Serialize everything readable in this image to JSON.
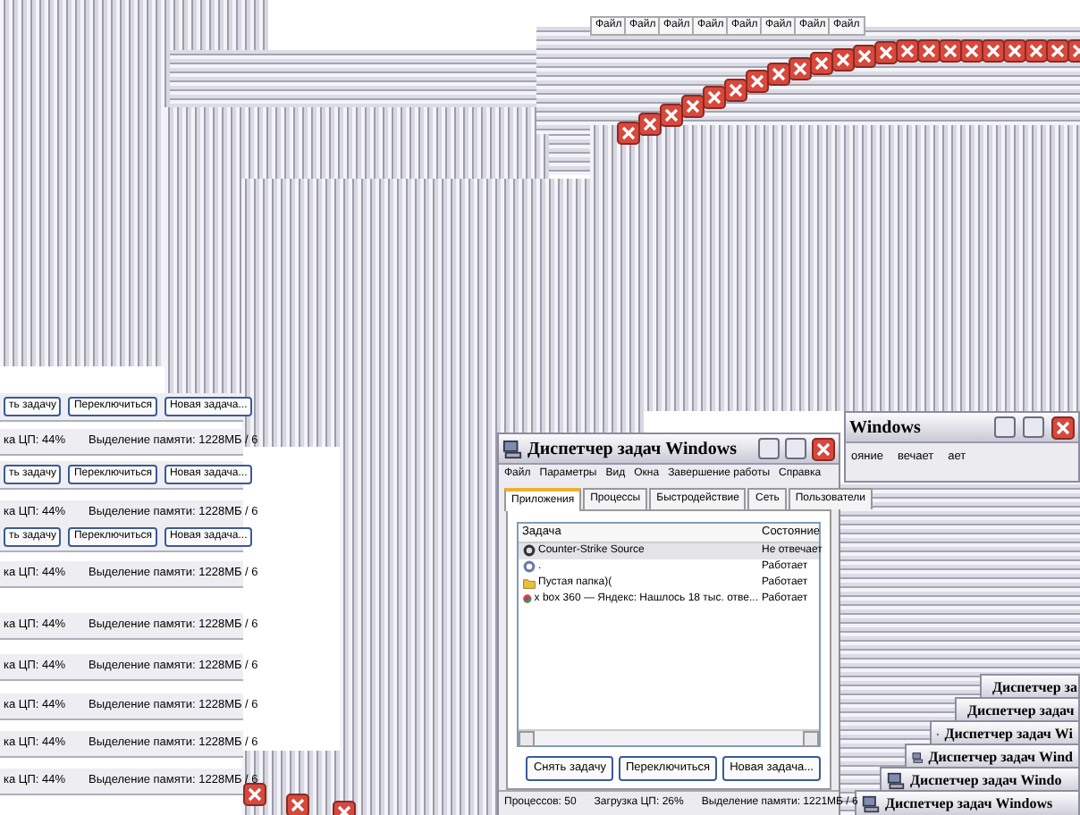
{
  "main_window": {
    "title": "Диспетчер задач Windows",
    "menu": [
      "Файл",
      "Параметры",
      "Вид",
      "Окна",
      "Завершение работы",
      "Справка"
    ],
    "tabs": [
      {
        "label": "Приложения",
        "selected": true
      },
      {
        "label": "Процессы",
        "selected": false
      },
      {
        "label": "Быстродействие",
        "selected": false
      },
      {
        "label": "Сеть",
        "selected": false
      },
      {
        "label": "Пользователи",
        "selected": false
      }
    ],
    "columns": [
      "Задача",
      "Состояние"
    ],
    "rows": [
      {
        "kind": "app",
        "task": "Counter-Strike Source",
        "status": "Не отвечает",
        "selected": true
      },
      {
        "kind": "blank",
        "task": ".",
        "status": "Работает",
        "selected": false
      },
      {
        "kind": "folder",
        "task": "Пустая папка)(",
        "status": "Работает",
        "selected": false
      },
      {
        "kind": "browser",
        "task": "x box 360 — Яндекс: Нашлось 18 тыс. отве...",
        "status": "Работает",
        "selected": false
      }
    ],
    "buttons": [
      "Снять задачу",
      "Переключиться",
      "Новая задача..."
    ],
    "status_bar": [
      "Процессов: 50",
      "Загрузка ЦП: 26%",
      "Выделение памяти: 1221МБ / 6"
    ]
  },
  "top_menu_labels": [
    "Файл",
    "Файл",
    "Файл",
    "Файл",
    "Файл",
    "Файл",
    "Файл",
    "Файл"
  ],
  "left_rows": [
    {
      "kind": "buttons",
      "texts": [
        "ть задачу",
        "Переключиться",
        "Новая задача..."
      ]
    },
    {
      "kind": "status",
      "texts": [
        "ка ЦП: 44%",
        "Выделение памяти: 1228МБ / 6"
      ]
    },
    {
      "kind": "buttons",
      "texts": [
        "ть задачу",
        "Переключиться",
        "Новая задача..."
      ]
    },
    {
      "kind": "status",
      "texts": [
        "ка ЦП: 44%",
        "Выделение памяти: 1228МБ / 6"
      ]
    },
    {
      "kind": "buttons",
      "texts": [
        "ть задачу",
        "Переключиться",
        "Новая задача..."
      ]
    },
    {
      "kind": "status",
      "texts": [
        "ка ЦП: 44%",
        "Выделение памяти: 1228МБ / 6"
      ]
    },
    {
      "kind": "status",
      "texts": [
        "ка ЦП: 44%",
        "Выделение памяти: 1228МБ / 6"
      ]
    },
    {
      "kind": "status",
      "texts": [
        "ка ЦП: 44%",
        "Выделение памяти: 1228МБ / 6"
      ]
    },
    {
      "kind": "status",
      "texts": [
        "ка ЦП: 44%",
        "Выделение памяти: 1228МБ / 6"
      ]
    },
    {
      "kind": "status",
      "texts": [
        "ка ЦП: 44%",
        "Выделение памяти: 1228МБ / 6"
      ]
    },
    {
      "kind": "status",
      "texts": [
        "ка ЦП: 44%",
        "Выделение памяти: 1228МБ / 6"
      ]
    }
  ],
  "right_window": {
    "title": "Windows",
    "texts": [
      "ояние",
      "вечает",
      "ает"
    ]
  },
  "cascade_titles": [
    "Диспетчер за",
    "Диспетчер задач",
    "Диспетчер задач Wi",
    "Диспетчер задач Wind",
    "Диспетчер задач Windo",
    "Диспетчер задач Windows"
  ]
}
